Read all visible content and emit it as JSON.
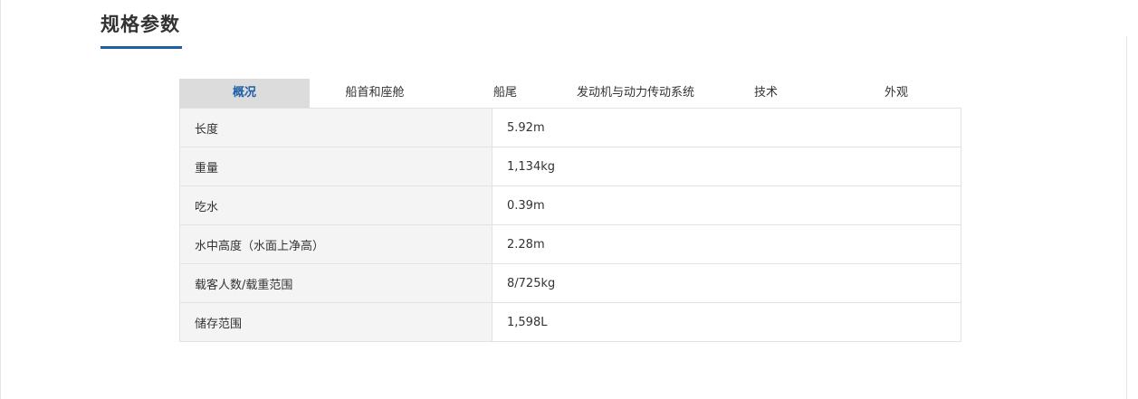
{
  "section": {
    "title": "规格参数"
  },
  "colors": {
    "accent": "#1f5fa8",
    "active_tab_bg": "#dcdcdc",
    "key_cell_bg": "#f4f4f4",
    "border": "#e2e2e2"
  },
  "tabs": [
    {
      "label": "概况",
      "active": true
    },
    {
      "label": "船首和座舱",
      "active": false
    },
    {
      "label": "船尾",
      "active": false
    },
    {
      "label": "发动机与动力传动系统",
      "active": false
    },
    {
      "label": "技术",
      "active": false
    },
    {
      "label": "外观",
      "active": false
    }
  ],
  "specs": {
    "rows": [
      {
        "key": "长度",
        "value": "5.92m"
      },
      {
        "key": "重量",
        "value": "1,134kg"
      },
      {
        "key": "吃水",
        "value": "0.39m"
      },
      {
        "key": "水中高度（水面上净高）",
        "value": "2.28m"
      },
      {
        "key": "载客人数/载重范围",
        "value": "8/725kg"
      },
      {
        "key": "储存范围",
        "value": "1,598L"
      }
    ]
  }
}
